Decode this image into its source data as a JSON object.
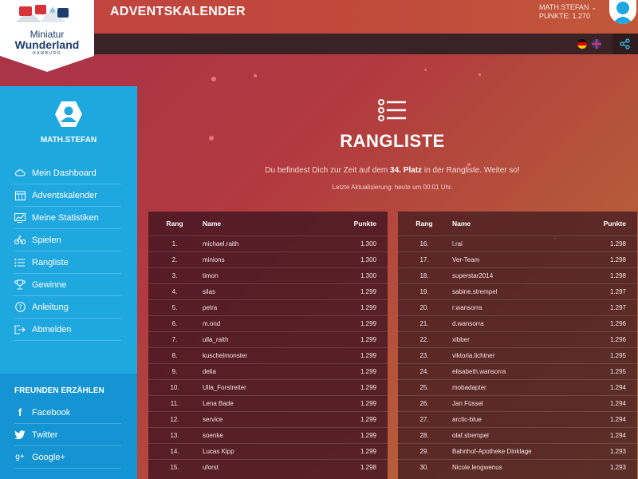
{
  "header": {
    "title": "ADVENTSKALENDER",
    "user_name": "MATH.STEFAN",
    "points_label": "PUNKTE: 1.270"
  },
  "logo": {
    "line1": "Miniatur",
    "line2": "Wunderland",
    "line3": "HAMBURG"
  },
  "sidebar": {
    "user_name": "MATH.STEFAN",
    "items": [
      {
        "label": "Mein Dashboard",
        "icon": "cloud-icon"
      },
      {
        "label": "Adventskalender",
        "icon": "calendar-icon"
      },
      {
        "label": "Meine Statistiken",
        "icon": "chart-icon"
      },
      {
        "label": "Spielen",
        "icon": "bike-icon"
      },
      {
        "label": "Rangliste",
        "icon": "list-icon"
      },
      {
        "label": "Gewinne",
        "icon": "trophy-icon"
      },
      {
        "label": "Anleitung",
        "icon": "question-icon"
      },
      {
        "label": "Abmelden",
        "icon": "logout-icon"
      }
    ],
    "share_title": "FREUNDEN ERZÄHLEN",
    "social": [
      {
        "label": "Facebook",
        "icon": "facebook-icon"
      },
      {
        "label": "Twitter",
        "icon": "twitter-icon"
      },
      {
        "label": "Google+",
        "icon": "googleplus-icon"
      }
    ]
  },
  "main": {
    "title": "RANGLISTE",
    "info_prefix": "Du befindest Dich zur Zeit auf dem ",
    "info_rank": "34. Platz",
    "info_suffix": " in der Rangliste. Weiter so!",
    "update": "Letzte Aktualisierung: heute um 00:01 Uhr."
  },
  "table": {
    "headers": {
      "rank": "Rang",
      "name": "Name",
      "points": "Punkte"
    },
    "left": [
      {
        "rank": "1.",
        "name": "michael.raith",
        "points": "1.300"
      },
      {
        "rank": "2.",
        "name": "minions",
        "points": "1.300"
      },
      {
        "rank": "3.",
        "name": "timon",
        "points": "1.300"
      },
      {
        "rank": "4.",
        "name": "silas",
        "points": "1.299"
      },
      {
        "rank": "5.",
        "name": "petra",
        "points": "1.299"
      },
      {
        "rank": "6.",
        "name": "m.ond",
        "points": "1.299"
      },
      {
        "rank": "7.",
        "name": "ulla_raith",
        "points": "1.299"
      },
      {
        "rank": "8.",
        "name": "kuschelmonster",
        "points": "1.299"
      },
      {
        "rank": "9.",
        "name": "delia",
        "points": "1.299"
      },
      {
        "rank": "10.",
        "name": "Ulla_Forstreiter",
        "points": "1.299"
      },
      {
        "rank": "11.",
        "name": "Lena Bade",
        "points": "1.299"
      },
      {
        "rank": "12.",
        "name": "service",
        "points": "1.299"
      },
      {
        "rank": "13.",
        "name": "soenke",
        "points": "1.299"
      },
      {
        "rank": "14.",
        "name": "Lucas Kipp",
        "points": "1.299"
      },
      {
        "rank": "15.",
        "name": "uforst",
        "points": "1.298"
      }
    ],
    "right": [
      {
        "rank": "16.",
        "name": "l.rai",
        "points": "1.298"
      },
      {
        "rank": "17.",
        "name": "Ver-Team",
        "points": "1.298"
      },
      {
        "rank": "18.",
        "name": "superstar2014",
        "points": "1.298"
      },
      {
        "rank": "19.",
        "name": "sabine.strempel",
        "points": "1.297"
      },
      {
        "rank": "20.",
        "name": "r.wansorra",
        "points": "1.297"
      },
      {
        "rank": "21.",
        "name": "d.wansorra",
        "points": "1.296"
      },
      {
        "rank": "22.",
        "name": "xibber",
        "points": "1.296"
      },
      {
        "rank": "23.",
        "name": "viktoria.lichtner",
        "points": "1.295"
      },
      {
        "rank": "24.",
        "name": "elisabeth.wansorra",
        "points": "1.295"
      },
      {
        "rank": "25.",
        "name": "mobadapter",
        "points": "1.294"
      },
      {
        "rank": "26.",
        "name": "Jan Füssel",
        "points": "1.294"
      },
      {
        "rank": "27.",
        "name": "arctic-blue",
        "points": "1.294"
      },
      {
        "rank": "28.",
        "name": "olaf.strempel",
        "points": "1.294"
      },
      {
        "rank": "29.",
        "name": "Bahnhof-Apotheke Dinklage",
        "points": "1.293"
      },
      {
        "rank": "30.",
        "name": "Nicole.lengwenus",
        "points": "1.293"
      }
    ]
  }
}
